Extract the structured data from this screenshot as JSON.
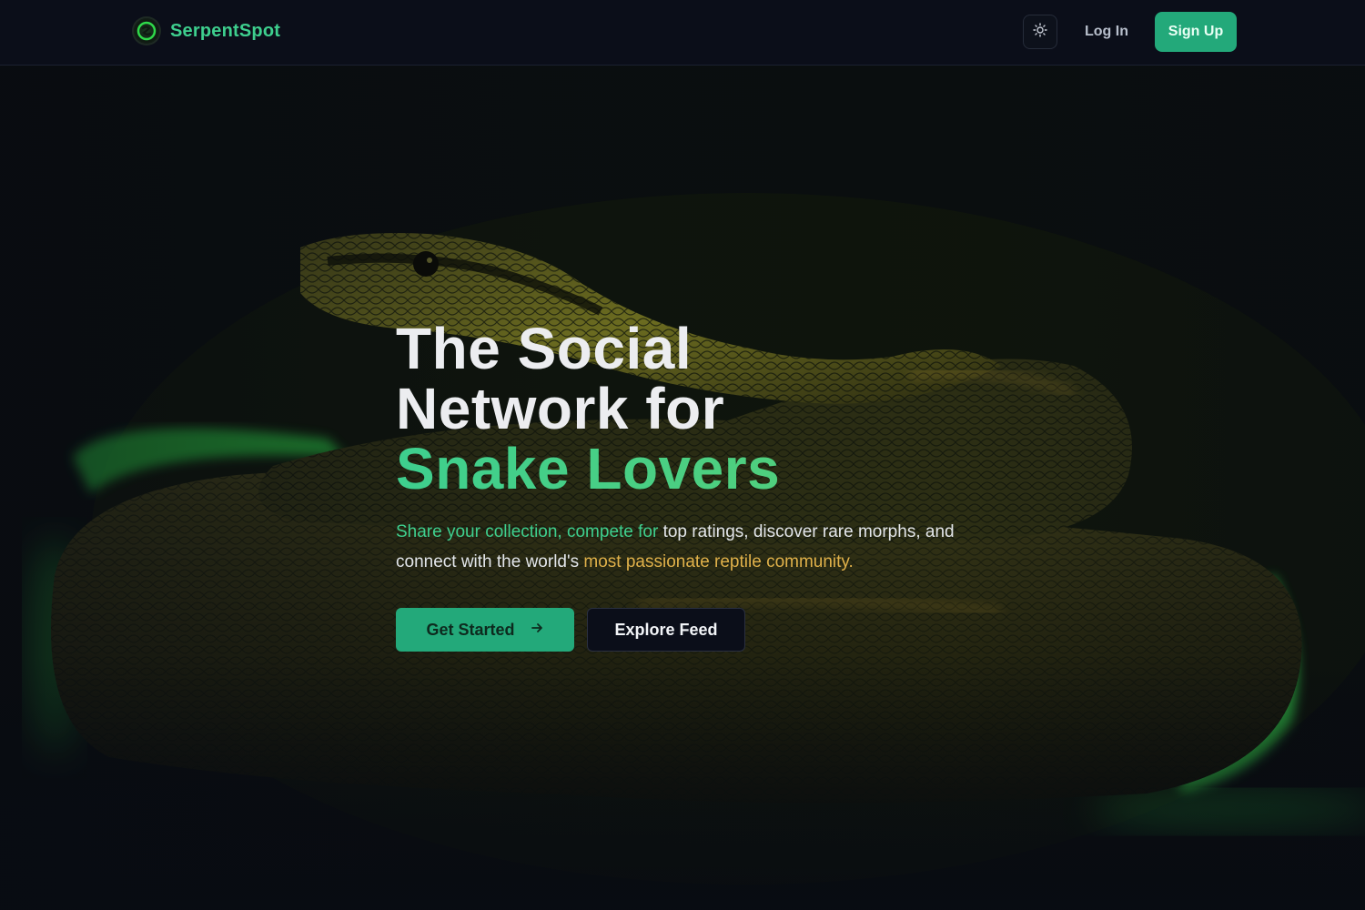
{
  "brand": {
    "name": "SerpentSpot",
    "logo_icon": "snake-logo-icon",
    "color": "#3ecf8e"
  },
  "nav": {
    "theme_toggle_icon": "sun-icon",
    "login_label": "Log In",
    "signup_label": "Sign Up"
  },
  "hero": {
    "title_line1": "The Social",
    "title_line2": "Network for",
    "title_accent": "Snake Lovers",
    "subtitle_part1": "Share your collection, compete for",
    "subtitle_part2": " top ratings, discover rare morphs, and connect with the world's ",
    "subtitle_part3": "most passionate reptile community.",
    "primary_cta": "Get Started",
    "primary_cta_icon": "arrow-right-icon",
    "secondary_cta": "Explore Feed",
    "background_image": "coiled-snake-photo"
  },
  "colors": {
    "accent": "#23a97a",
    "accent_text": "#3ecf8e",
    "gold": "#e0b14a",
    "background": "#0b0e19"
  }
}
